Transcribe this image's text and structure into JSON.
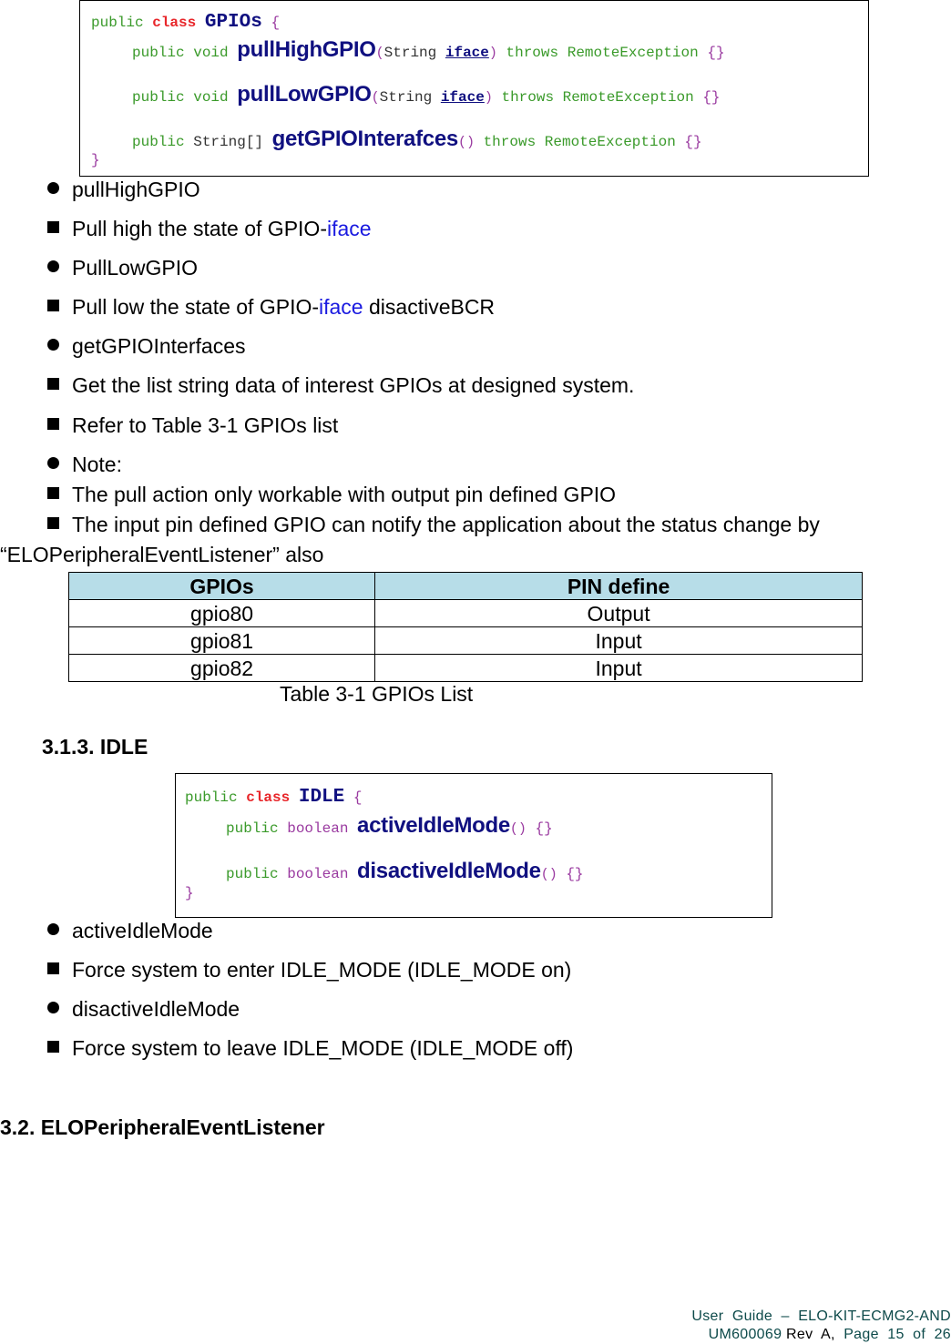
{
  "gpios_code": {
    "line1": {
      "public": "public",
      "class": "class",
      "name": "GPIOs",
      "brace": "{"
    },
    "methods": [
      {
        "public": "public",
        "ret": "void",
        "name": "pullHighGPIO",
        "open": "(",
        "ptype": "String",
        "param": "iface",
        "close": ")",
        "throws": "throws RemoteException",
        "body": "{}"
      },
      {
        "public": "public",
        "ret": "void",
        "name": "pullLowGPIO",
        "open": "(",
        "ptype": "String",
        "param": "iface",
        "close": ")",
        "throws": "throws RemoteException",
        "body": "{}"
      },
      {
        "public": "public",
        "ret": "String[]",
        "name": "getGPIOInterafces",
        "parens": "()",
        "throws": "throws RemoteException",
        "body": "{}"
      }
    ],
    "close": "}"
  },
  "gpio_items": [
    {
      "type": "dot",
      "text": "pullHighGPIO"
    },
    {
      "type": "square",
      "text": "Pull high the state of GPIO-",
      "highlight": "iface"
    },
    {
      "type": "dot",
      "text": "PullLowGPIO"
    },
    {
      "type": "square",
      "text": "Pull low the state of GPIO-",
      "highlight": "iface",
      "tail": " disactiveBCR"
    },
    {
      "type": "dot",
      "text": "getGPIOInterfaces"
    },
    {
      "type": "square",
      "text": "Get the list string data of interest GPIOs at designed system."
    },
    {
      "type": "square",
      "text": "Refer to Table 3-1 GPIOs list"
    },
    {
      "type": "dot",
      "text": "Note:"
    },
    {
      "type": "square",
      "text": "The pull action only workable with output pin defined GPIO"
    },
    {
      "type": "square",
      "text": "The input pin defined GPIO can notify the application about the status change by"
    }
  ],
  "note_continuation": "“ELOPeripheralEventListener” also",
  "table": {
    "headers": [
      "GPIOs",
      "PIN define"
    ],
    "rows": [
      [
        "gpio80",
        "Output"
      ],
      [
        "gpio81",
        "Input"
      ],
      [
        "gpio82",
        "Input"
      ]
    ],
    "caption": "Table 3-1 GPIOs List",
    "header_color": "#b7dde8"
  },
  "section_idle": "3.1.3. IDLE",
  "idle_code": {
    "line1": {
      "public": "public",
      "class": "class",
      "name": "IDLE",
      "brace": "{"
    },
    "methods": [
      {
        "public": "public",
        "ret": "boolean",
        "name": "activeIdleMode",
        "parens": "()",
        "body": "{}"
      },
      {
        "public": "public",
        "ret": "boolean",
        "name": "disactiveIdleMode",
        "parens": "()",
        "body": "{}"
      }
    ],
    "close": "}"
  },
  "idle_items": [
    {
      "type": "dot",
      "text": "activeIdleMode"
    },
    {
      "type": "square",
      "text": "Force system to enter IDLE_MODE (IDLE_MODE on)"
    },
    {
      "type": "dot",
      "text": "disactiveIdleMode"
    },
    {
      "type": "square",
      "text": "Force system to leave IDLE_MODE (IDLE_MODE off)"
    }
  ],
  "section_listener": "3.2. ELOPeripheralEventListener",
  "footer": {
    "line1": "User  Guide  –  ELO-KIT-ECMG2-AND",
    "doc_id": "UM600069",
    "rev": " Rev  A, ",
    "page": " Page  15  of  26"
  },
  "colors": {
    "keyword_public": "#3a9a2a",
    "keyword_class": "#e8262a",
    "method_name": "#101080",
    "punctuation": "#9a3aa0",
    "highlight_blue": "#1a1ae0",
    "footer_teal": "#0d4a4a"
  }
}
